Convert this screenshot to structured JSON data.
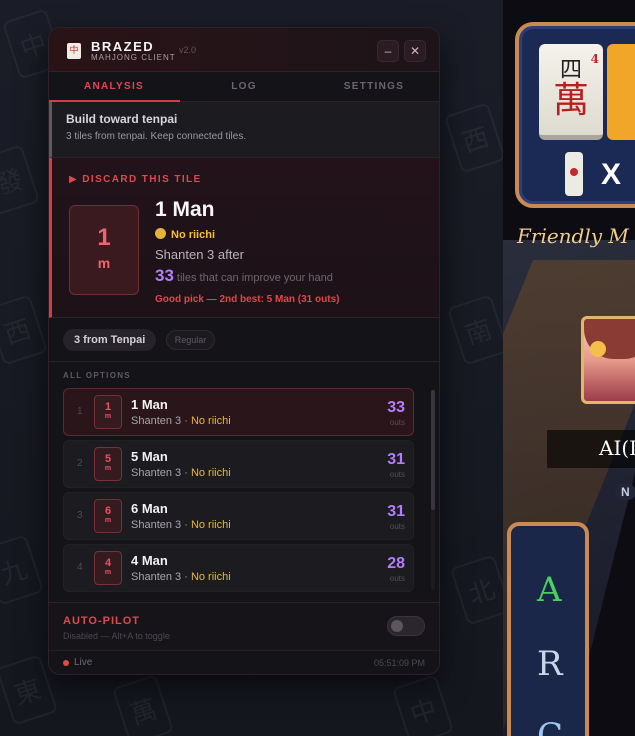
{
  "app": {
    "name": "BRAZED",
    "subtitle": "MAHJONG CLIENT",
    "version": "v2.0",
    "logo_glyph": "中"
  },
  "window_controls": {
    "minimize": "–",
    "close": "✕"
  },
  "tabs": [
    {
      "label": "ANALYSIS",
      "active": true
    },
    {
      "label": "LOG",
      "active": false
    },
    {
      "label": "SETTINGS",
      "active": false
    }
  ],
  "advice": {
    "title": "Build toward tenpai",
    "subtitle": "3 tiles from tenpai. Keep connected tiles."
  },
  "discard": {
    "heading": "▶ DISCARD THIS TILE",
    "tile_number": "1",
    "tile_suit": "m",
    "name": "1 Man",
    "riichi": "No riichi",
    "shanten": "Shanten 3 after",
    "outs": "33",
    "outs_text": "tiles that can improve your hand",
    "pick_note": "Good pick — 2nd best: 5 Man (31 outs)"
  },
  "chips": {
    "primary": "3 from Tenpai",
    "secondary": "Regular"
  },
  "options_header": "ALL OPTIONS",
  "options": [
    {
      "idx": "1",
      "num": "1",
      "suit": "m",
      "name": "1 Man",
      "shanten": "Shanten 3 · ",
      "riichi": "No riichi",
      "outs": "33",
      "outs_label": "outs"
    },
    {
      "idx": "2",
      "num": "5",
      "suit": "m",
      "name": "5 Man",
      "shanten": "Shanten 3 · ",
      "riichi": "No riichi",
      "outs": "31",
      "outs_label": "outs"
    },
    {
      "idx": "3",
      "num": "6",
      "suit": "m",
      "name": "6 Man",
      "shanten": "Shanten 3 · ",
      "riichi": "No riichi",
      "outs": "31",
      "outs_label": "outs"
    },
    {
      "idx": "4",
      "num": "4",
      "suit": "m",
      "name": "4 Man",
      "shanten": "Shanten 3 · ",
      "riichi": "No riichi",
      "outs": "28",
      "outs_label": "outs"
    }
  ],
  "autopilot": {
    "title": "AUTO-PILOT",
    "subtitle": "Disabled — Alt+A to toggle",
    "enabled": false
  },
  "status": {
    "live": "Live",
    "time": "05:51:09 PM"
  },
  "game": {
    "tile_top": "四",
    "tile_bottom": "萬",
    "tile_superscript": "4",
    "x_mark": "X",
    "banner": "Friendly M",
    "opponent": "AI(I",
    "nav_label": "N",
    "arc_letters": [
      "A",
      "R",
      "C"
    ]
  },
  "background_glyphs": [
    "中",
    "發",
    "西",
    "萬",
    "九",
    "東",
    "南",
    "北"
  ],
  "colors": {
    "accent": "#d83a44",
    "outs": "#b47cff",
    "riichi": "#f5bf3a"
  }
}
